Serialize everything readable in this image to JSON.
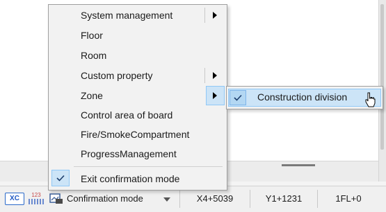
{
  "menu": {
    "items": [
      {
        "label": "System management",
        "has_submenu": true
      },
      {
        "label": "Floor",
        "has_submenu": false
      },
      {
        "label": "Room",
        "has_submenu": false
      },
      {
        "label": "Custom property",
        "has_submenu": true
      },
      {
        "label": "Zone",
        "has_submenu": true,
        "highlighted": true
      },
      {
        "label": "Control area of board",
        "has_submenu": false
      },
      {
        "label": "Fire/SmokeCompartment",
        "has_submenu": false
      },
      {
        "label": "ProgressManagement",
        "has_submenu": false
      }
    ],
    "exit_item": {
      "label": "Exit confirmation mode",
      "checked": true
    }
  },
  "submenu": {
    "items": [
      {
        "label": "Construction division",
        "checked": true,
        "hovered": true
      }
    ]
  },
  "statusbar": {
    "xc_icon_text": "XC",
    "num_icon_text": "123",
    "mode_label": "Confirmation mode",
    "x_coord": "X4+5039",
    "y_coord": "Y1+1231",
    "floor": "1FL+0"
  },
  "icons": {
    "check": "check-icon",
    "submenu_arrow": "triangle-right-icon",
    "dropdown": "triangle-down-icon",
    "cursor": "mouse-pointer-icon"
  },
  "colors": {
    "highlight_fill": "#cce4f7",
    "highlight_border": "#90c8f6",
    "menu_bg": "#f2f2f2",
    "statusbar_bg": "#f0f0f0"
  }
}
